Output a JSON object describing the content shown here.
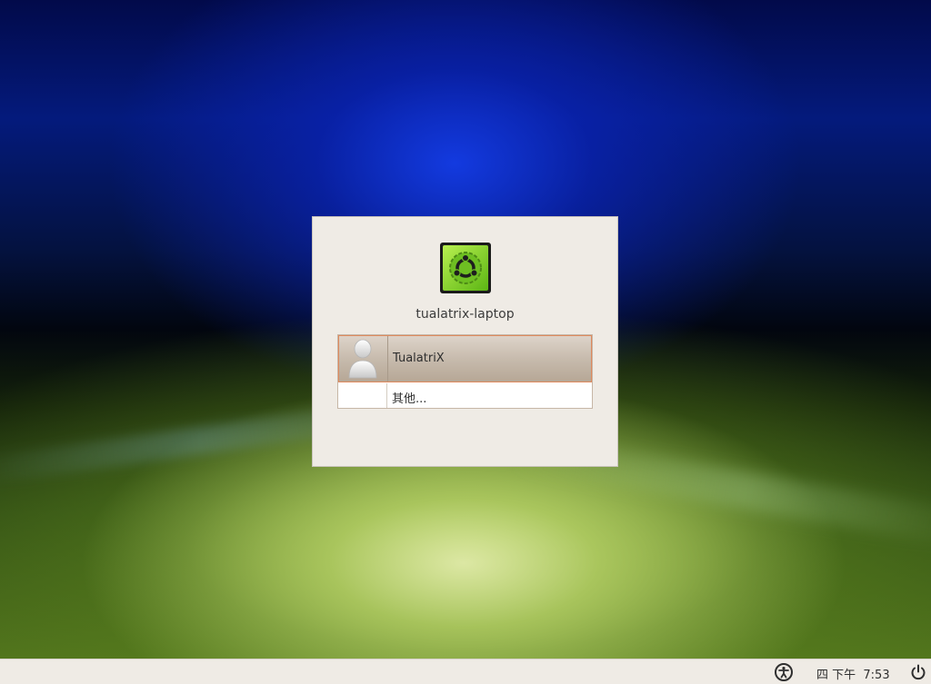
{
  "login": {
    "hostname": "tualatrix-laptop",
    "users": [
      {
        "label": "TualatriX",
        "selected": true,
        "avatar": "default-user-avatar-icon"
      },
      {
        "label": "其他..."
      }
    ]
  },
  "panel": {
    "clock": "四 下午  7:53",
    "icons": [
      "accessibility-icon",
      "power-icon"
    ]
  },
  "colors": {
    "dialog_bg": "#efebe5",
    "selection_border": "#e08a5e",
    "logo_green": "#7ed321"
  }
}
